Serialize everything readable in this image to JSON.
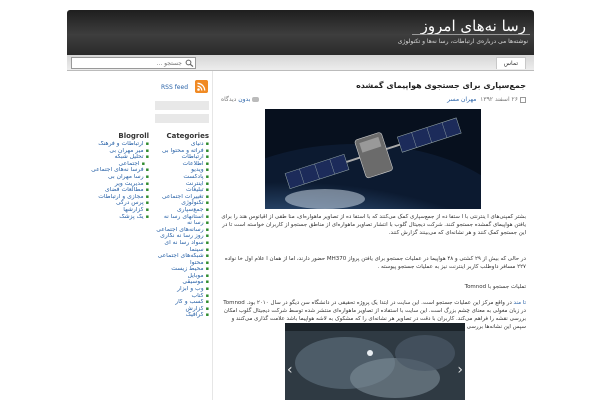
{
  "header": {
    "title": "رسا نه‌های امروز",
    "tagline": "نوشته‌ها می درباره‌ی ارتباطات، رسا نه‌ها و تکنولوژی"
  },
  "nav": {
    "search_placeholder": "جستجو ...",
    "tab_label": "تماس"
  },
  "post": {
    "title": "جمع‌سپاری برای جستجوی هواپیمای گمشده",
    "date": "۲۶ اسفند ۱۳۹۲",
    "author": "مهران مسر",
    "comments": "دیدگاه",
    "comments_link": "بدون",
    "p1": "بشتر کمپنی‌های ا ینترنتی با ا ستفا ده از جمع‌سپاری کمک می‌کنند که با استفا ده از تصاویر ماهواره‌ای، منا طقی از اقیانوس هند را برای یافتن هواپیمای گمشده جستجو کنند. شرکت دیجیتال گلوب با انتشار تصاویر ماهواره‌ای از مناطق جستجو از کاربران خواسته است تا در این جستجو کمک کنند و هر نشانه‌ای که می‌بینند گزارش کنند.",
    "p2": "در حالی که بیش از ۲۹ کشتی و ۴۸ هواپیما در عملیات جستجو برای یافتن پرواز MH370 حضور دارند، اما از همان ا علام اول خا نواده ۲۲۷ مسافر داوطلب کاربر اینترنت نیز به عملیات جستجو پیوسته .",
    "p3": "تملیات جستجو با Tomnod",
    "p4_link": "تا مند",
    "p4": "در واقع مرکز این عملیات جستجو است. این سایت در ابتدا یک پروژه تحقیقی در دانشگاه سن دیگو در سال ۲۰۱۰ بود. Tomnod در زبان مغولی به معنای چشم بزرگ است. این سایت با استفاده از تصاویر ماهواره‌ای منتشر شده توسط شرکت دیجیتال گلوب امکان بررسی نقشه را فراهم می‌کند. کاربران با دقت در تصاویر هر نشانه‌ای را که مشکوک به لاشه هواپیما باشد علامت گذاری می‌کنند و سپس این نشانه‌ها بررسی می‌شوند. تا کنون بیش از ۳ میلیون نفر در این جستجو شرکت کرده‌اند."
  },
  "rss": {
    "label": "RSS feed"
  },
  "categories": {
    "title": "Categories",
    "items": [
      {
        "label": "دنیای",
        "sub": false
      },
      {
        "label": "فراته و محتوا بی",
        "sub": false
      },
      {
        "label": "ارتباطات",
        "sub": false
      },
      {
        "label": "اطلاعات",
        "sub": false
      },
      {
        "label": "ویدیو",
        "sub": false
      },
      {
        "label": "پادکست",
        "sub": false
      },
      {
        "label": "اینترنت",
        "sub": false
      },
      {
        "label": "تبلیغات",
        "sub": false
      },
      {
        "label": "تغییرات اجتماعی",
        "sub": false
      },
      {
        "label": "تکنولوژی",
        "sub": false
      },
      {
        "label": "جمع‌سپاری",
        "sub": false
      },
      {
        "label": "استانهای رسا نه",
        "sub": false
      },
      {
        "label": "رسا نه",
        "sub": false
      },
      {
        "label": "رسانه‌های اجتماعی",
        "sub": false
      },
      {
        "label": "روز رسا نه نگاری",
        "sub": false
      },
      {
        "label": "سواد رسا نه ای",
        "sub": false
      },
      {
        "label": "سینما",
        "sub": false
      },
      {
        "label": "شبکه‌های اجتماعی",
        "sub": false
      },
      {
        "label": "محتوا",
        "sub": false
      },
      {
        "label": "محیط زیست",
        "sub": false
      },
      {
        "label": "موبایل",
        "sub": false
      },
      {
        "label": "موسیقی",
        "sub": false
      },
      {
        "label": "وب و ابزار",
        "sub": false
      },
      {
        "label": "کتاب",
        "sub": false
      },
      {
        "label": "کسب و کار",
        "sub": false
      },
      {
        "label": "گزارش",
        "sub": false
      },
      {
        "label": "گرافیک",
        "sub": false
      }
    ]
  },
  "blogroll": {
    "title": "Blogroll",
    "items": [
      {
        "label": "ارتباطات و فرهنگ",
        "sub": false
      },
      {
        "label": "میر مهران بی",
        "sub": false
      },
      {
        "label": "تحلیل شبکه",
        "sub": false
      },
      {
        "label": "اجتماعی",
        "sub": true
      },
      {
        "label": "فرسا نه‌های اجتماعی",
        "sub": false
      },
      {
        "label": "رسا مهران بی",
        "sub": false
      },
      {
        "label": "مدیریت ویر",
        "sub": false
      },
      {
        "label": "مطالعات فضای",
        "sub": false
      },
      {
        "label": "مجازی و ارتباطات",
        "sub": false
      },
      {
        "label": "پرس درگی",
        "sub": false
      },
      {
        "label": "گزارشها",
        "sub": false
      },
      {
        "label": "یک پزشک",
        "sub": false
      }
    ]
  }
}
